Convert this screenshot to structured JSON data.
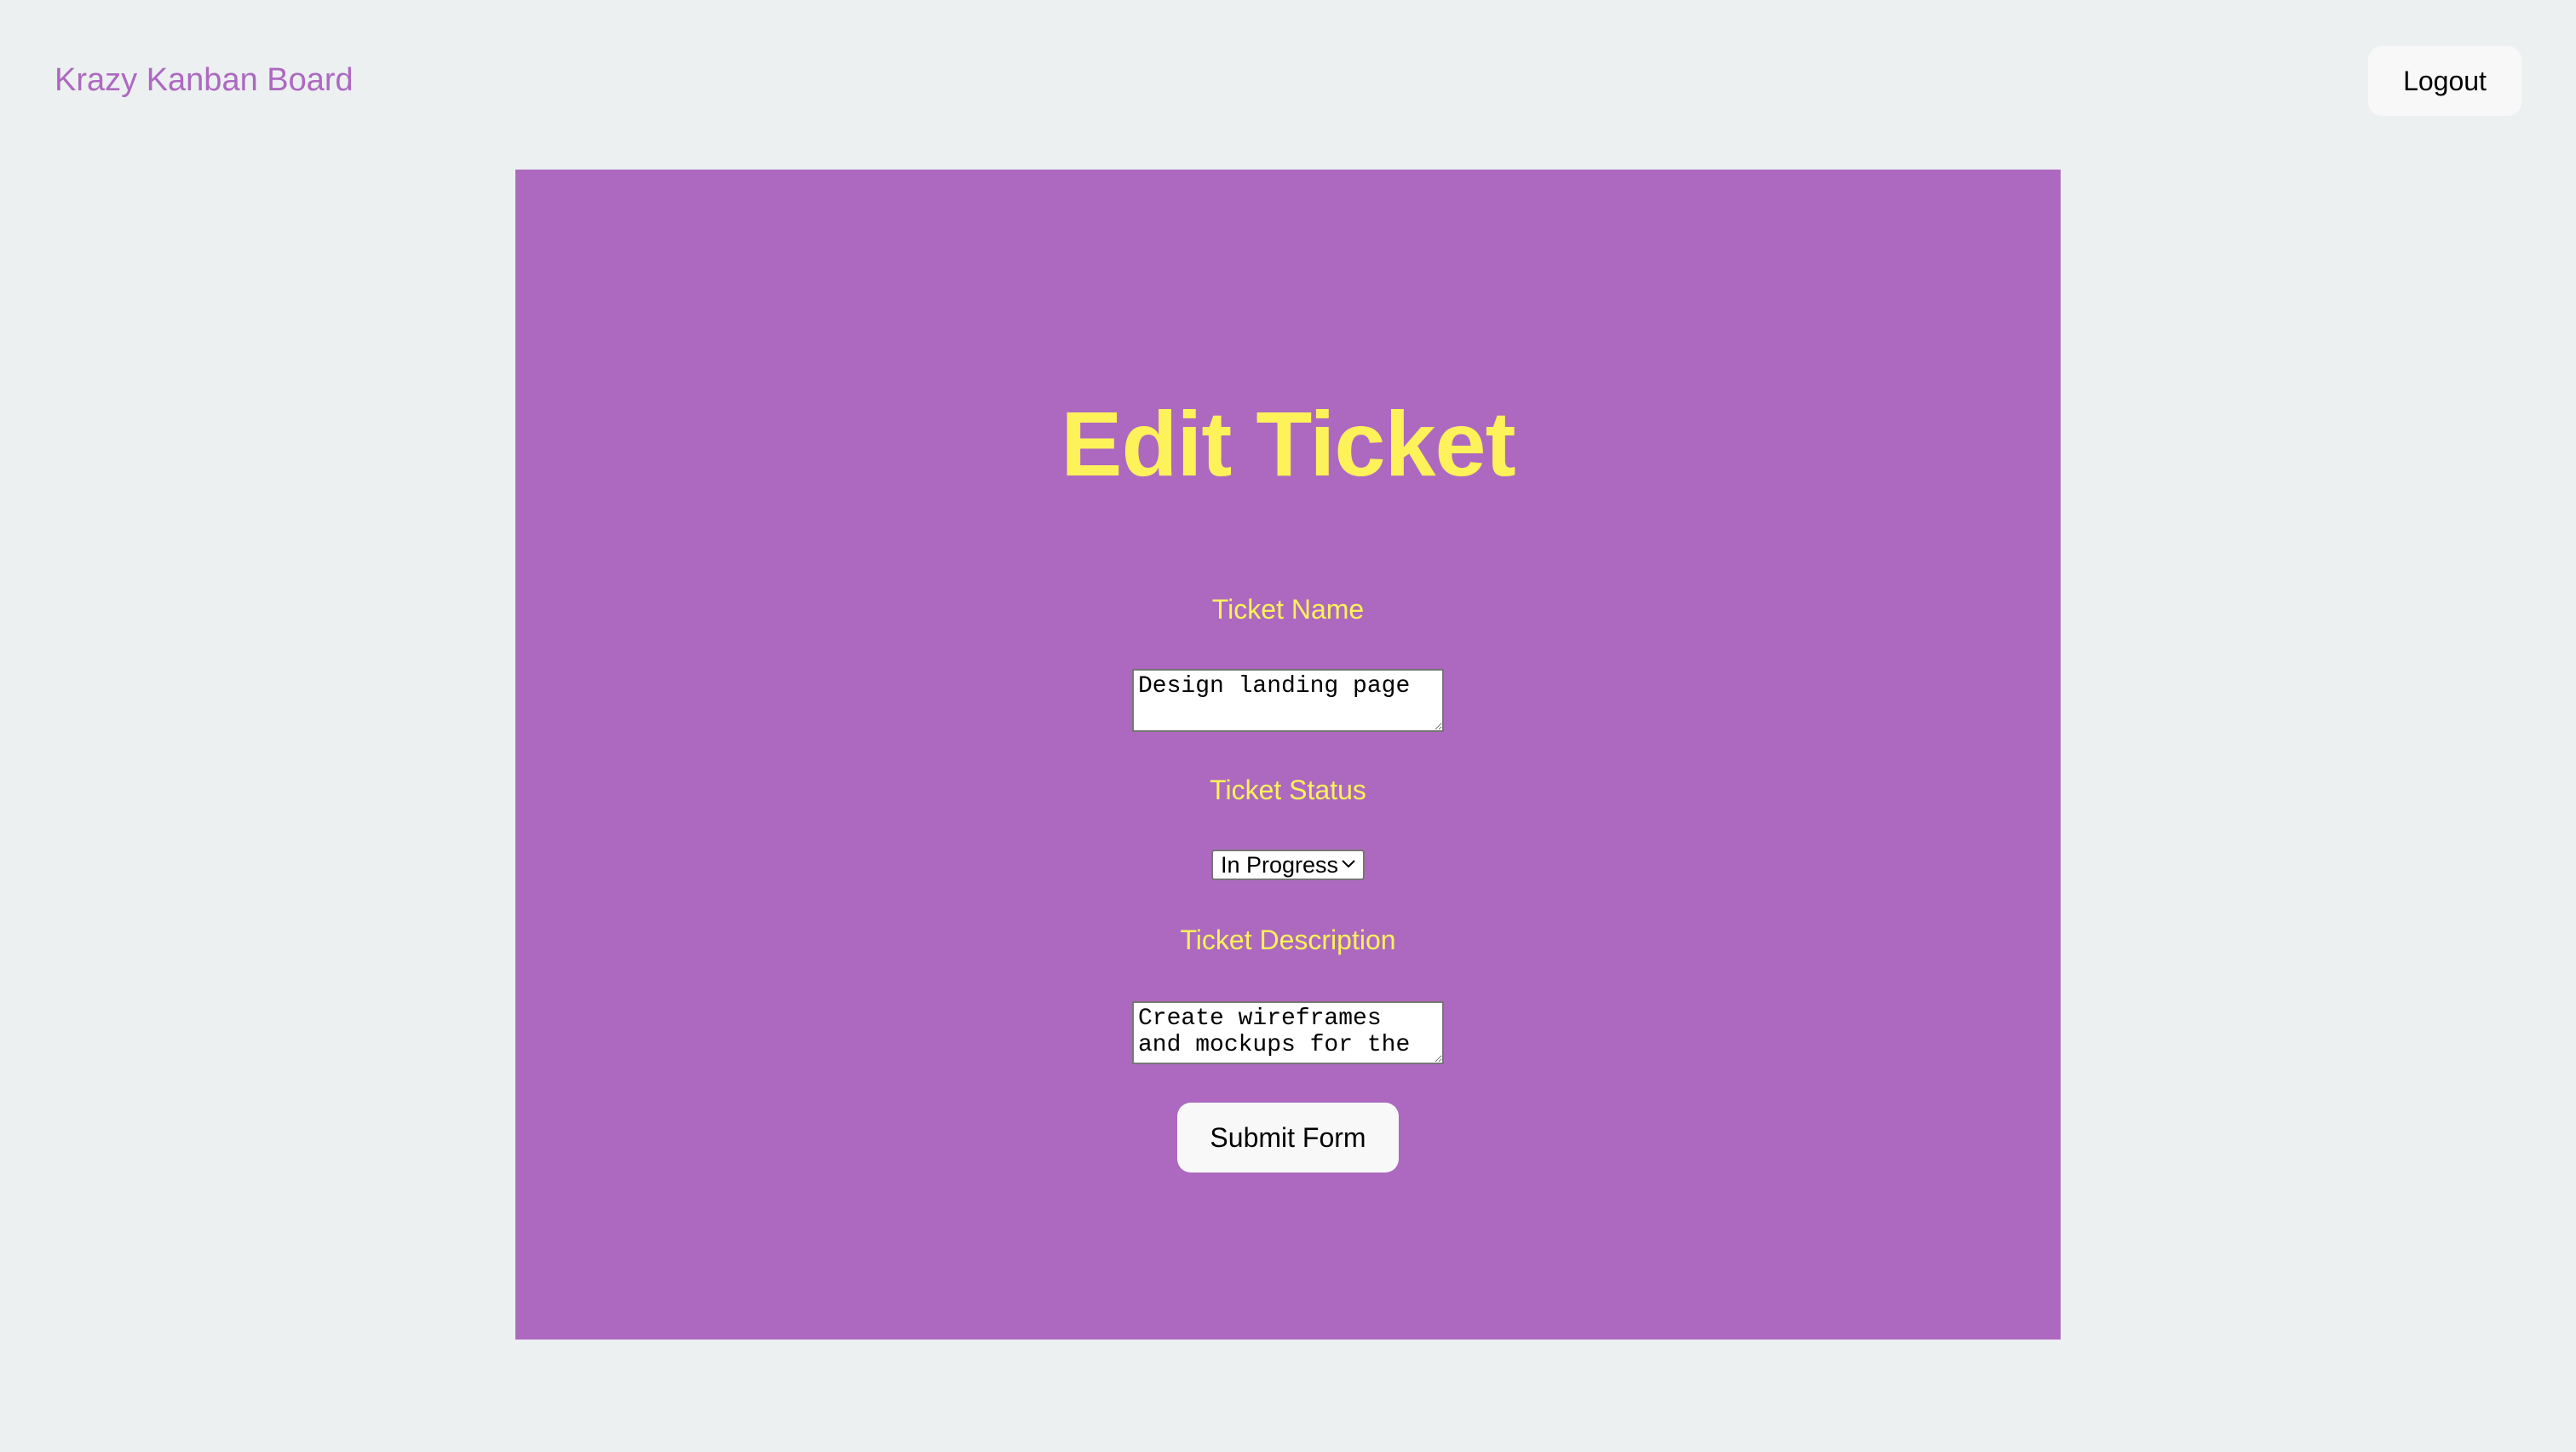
{
  "navbar": {
    "brand": "Krazy Kanban Board",
    "logout_label": "Logout"
  },
  "form": {
    "title": "Edit Ticket",
    "name_label": "Ticket Name",
    "name_value": "Design landing page",
    "status_label": "Ticket Status",
    "status_value": "In Progress",
    "description_label": "Ticket Description",
    "description_value": "Create wireframes and mockups for the",
    "submit_label": "Submit Form"
  },
  "icons": {
    "select_arrow": "chevron-down-icon"
  },
  "colors": {
    "background": "#ecf0f1",
    "panel": "#ad69c0",
    "accent_text": "#fdf25a",
    "brand_text": "#ad69c0",
    "button": "#f8f8f8"
  }
}
